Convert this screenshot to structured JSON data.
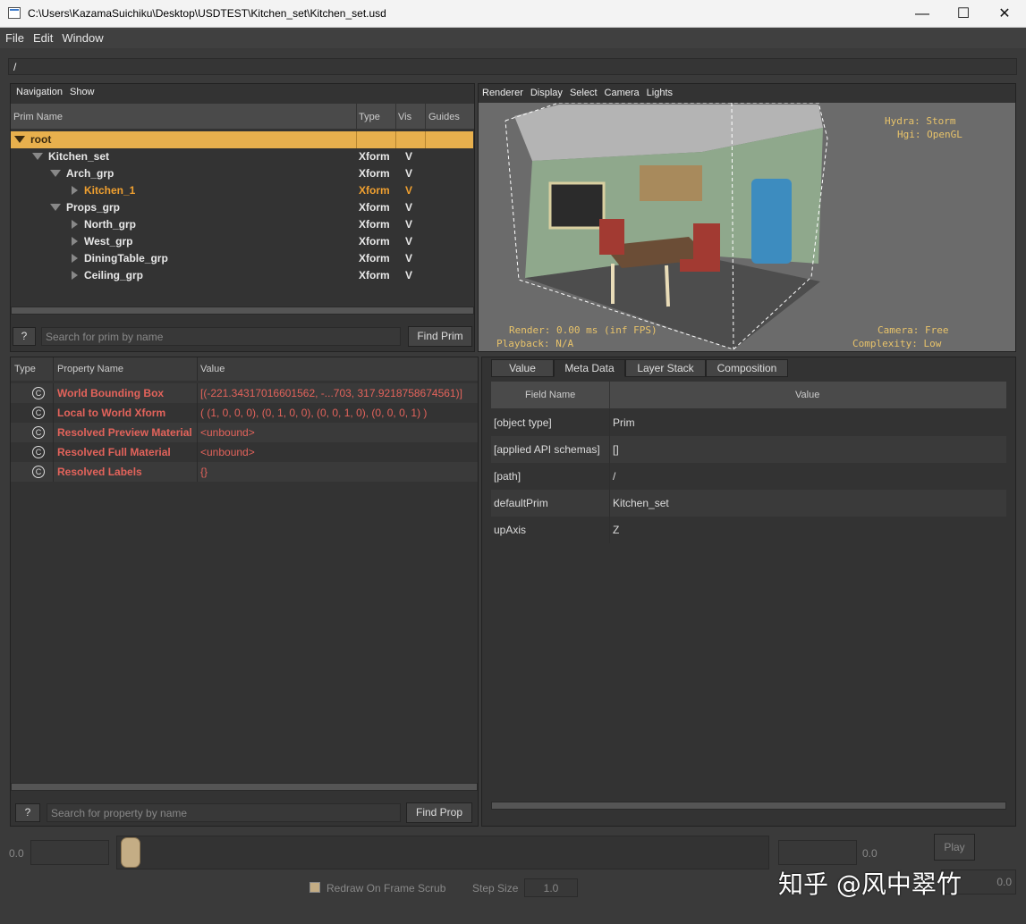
{
  "window": {
    "title": "C:\\Users\\KazamaSuichiku\\Desktop\\USDTEST\\Kitchen_set\\Kitchen_set.usd",
    "minimize": "—",
    "maximize": "☐",
    "close": "✕"
  },
  "menu": [
    "File",
    "Edit",
    "Window"
  ],
  "path": "/",
  "navigation": {
    "menu": [
      "Navigation",
      "Show"
    ],
    "columns": [
      "Prim Name",
      "Type",
      "Vis",
      "Guides"
    ],
    "rows": [
      {
        "name": "root",
        "type": "Xform",
        "vis": ""
      },
      {
        "name": "Kitchen_set",
        "type": "Xform",
        "vis": "V"
      },
      {
        "name": "Arch_grp",
        "type": "Xform",
        "vis": "V"
      },
      {
        "name": "Kitchen_1",
        "type": "Xform",
        "vis": "V"
      },
      {
        "name": "Props_grp",
        "type": "Xform",
        "vis": "V"
      },
      {
        "name": "North_grp",
        "type": "Xform",
        "vis": "V"
      },
      {
        "name": "West_grp",
        "type": "Xform",
        "vis": "V"
      },
      {
        "name": "DiningTable_grp",
        "type": "Xform",
        "vis": "V"
      },
      {
        "name": "Ceiling_grp",
        "type": "Xform",
        "vis": "V"
      }
    ],
    "help": "?",
    "search_placeholder": "Search for prim by name",
    "find_label": "Find Prim"
  },
  "viewport": {
    "menu": [
      "Renderer",
      "Display",
      "Select",
      "Camera",
      "Lights"
    ],
    "hydra": "Hydra: Storm",
    "hgi": "Hgi: OpenGL",
    "render": "Render: 0.00 ms (inf FPS)",
    "playback": "Playback: N/A",
    "camera": "Camera: Free",
    "complexity": "Complexity: Low"
  },
  "properties": {
    "columns": [
      "Type",
      "Property Name",
      "Value"
    ],
    "rows": [
      {
        "icon": "C",
        "name": "World Bounding Box",
        "value": "[(-221.34317016601562, -...703, 317.9218758674561)]"
      },
      {
        "icon": "C",
        "name": "Local to World Xform",
        "value": "( (1, 0, 0, 0), (0, 1, 0, 0), (0, 0, 1, 0), (0, 0, 0, 1) )"
      },
      {
        "icon": "C",
        "name": "Resolved Preview Material",
        "value": "<unbound>"
      },
      {
        "icon": "C",
        "name": "Resolved Full Material",
        "value": "<unbound>"
      },
      {
        "icon": "C",
        "name": "Resolved Labels",
        "value": "{}"
      }
    ],
    "help": "?",
    "search_placeholder": "Search for property by name",
    "find_label": "Find Prop"
  },
  "metadata": {
    "tabs": [
      "Value",
      "Meta Data",
      "Layer Stack",
      "Composition"
    ],
    "active_tab": "Meta Data",
    "columns": [
      "Field Name",
      "Value"
    ],
    "rows": [
      {
        "field": "[object type]",
        "value": "Prim"
      },
      {
        "field": "[applied API schemas]",
        "value": "[]"
      },
      {
        "field": "[path]",
        "value": "/"
      },
      {
        "field": "defaultPrim",
        "value": "Kitchen_set"
      },
      {
        "field": "upAxis",
        "value": "Z"
      }
    ]
  },
  "timeline": {
    "start": "0.0",
    "end": "0.0",
    "play": "Play",
    "redraw_label": "Redraw On Frame Scrub",
    "step_label": "Step Size",
    "step_value": "1.0",
    "frame_field_right": "0.0"
  },
  "watermark": "知乎 @风中翠竹",
  "colors": {
    "selected_row": "#e8b04d",
    "highlight_text": "#f0a030",
    "property_text": "#e3635b",
    "hud_text": "#e8c36a"
  }
}
